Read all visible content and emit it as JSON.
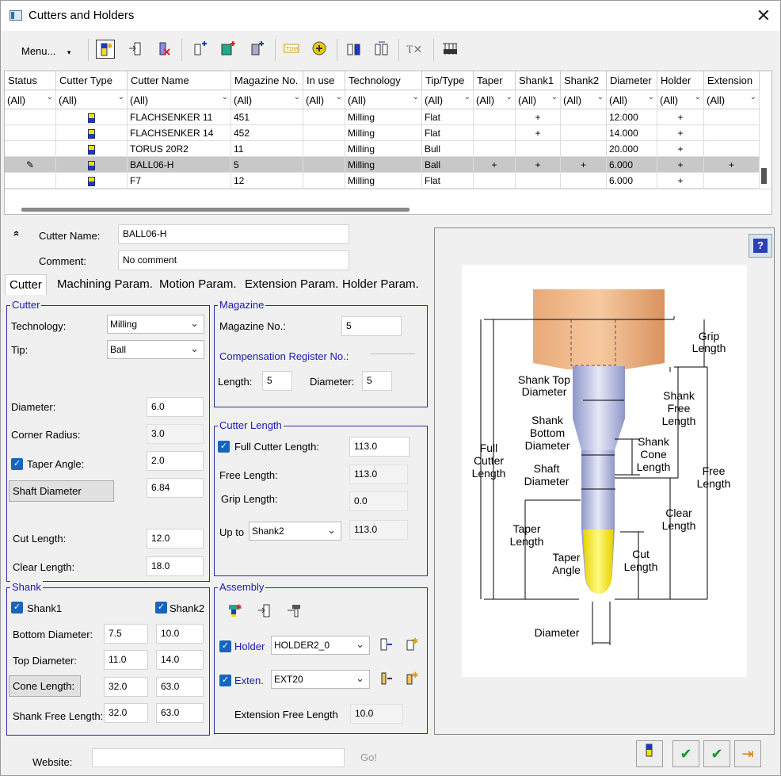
{
  "window": {
    "title": "Cutters and Holders"
  },
  "toolbar": {
    "menu_label": "Menu...",
    "menu_arrow": "▾"
  },
  "grid": {
    "columns": [
      "Status",
      "Cutter Type",
      "Cutter Name",
      "Magazine No.",
      "In use",
      "Technology",
      "Tip/Type",
      "Taper",
      "Shank1",
      "Shank2",
      "Diameter",
      "Holder",
      "Extension"
    ],
    "filter": "(All)",
    "rows": [
      {
        "status": "",
        "name": "FLACHSENKER 11",
        "mag": "451",
        "inuse": "",
        "tech": "Milling",
        "tip": "Flat",
        "taper": "",
        "shank1": "+",
        "shank2": "",
        "diam": "12.000",
        "holder": "+",
        "ext": ""
      },
      {
        "status": "",
        "name": "FLACHSENKER 14",
        "mag": "452",
        "inuse": "",
        "tech": "Milling",
        "tip": "Flat",
        "taper": "",
        "shank1": "+",
        "shank2": "",
        "diam": "14.000",
        "holder": "+",
        "ext": ""
      },
      {
        "status": "",
        "name": "TORUS 20R2",
        "mag": "11",
        "inuse": "",
        "tech": "Milling",
        "tip": "Bull",
        "taper": "",
        "shank1": "",
        "shank2": "",
        "diam": "20.000",
        "holder": "+",
        "ext": ""
      },
      {
        "status": "✎",
        "name": "BALL06-H",
        "mag": "5",
        "inuse": "",
        "tech": "Milling",
        "tip": "Ball",
        "taper": "+",
        "shank1": "+",
        "shank2": "+",
        "diam": "6.000",
        "holder": "+",
        "ext": "+"
      },
      {
        "status": "",
        "name": "F7",
        "mag": "12",
        "inuse": "",
        "tech": "Milling",
        "tip": "Flat",
        "taper": "",
        "shank1": "",
        "shank2": "",
        "diam": "6.000",
        "holder": "+",
        "ext": ""
      }
    ]
  },
  "form": {
    "collapse_icon": "«",
    "cutter_name_label": "Cutter Name:",
    "cutter_name": "BALL06-H",
    "comment_label": "Comment:",
    "comment": "No comment"
  },
  "tabs": [
    "Cutter",
    "Machining Param.",
    "Motion Param.",
    "Extension Param.",
    "Holder Param."
  ],
  "cutter": {
    "title": "Cutter",
    "technology_label": "Technology:",
    "technology": "Milling",
    "tip_label": "Tip:",
    "tip": "Ball",
    "diameter_label": "Diameter:",
    "diameter": "6.0",
    "corner_radius_label": "Corner Radius:",
    "corner_radius": "3.0",
    "taper_angle_label": "Taper Angle:",
    "taper_angle": "2.0",
    "shaft_diameter_label": "Shaft Diameter",
    "shaft_diameter": "6.84",
    "cut_length_label": "Cut Length:",
    "cut_length": "12.0",
    "clear_length_label": "Clear Length:",
    "clear_length": "18.0"
  },
  "magazine": {
    "title": "Magazine",
    "mag_no_label": "Magazine No.:",
    "mag_no": "5",
    "comp_label": "Compensation Register No.:",
    "length_label": "Length:",
    "length": "5",
    "diameter_label": "Diameter:",
    "diameter": "5"
  },
  "cutter_length": {
    "title": "Cutter Length",
    "full_label": "Full Cutter Length:",
    "full": "113.0",
    "free_label": "Free Length:",
    "free": "113.0",
    "grip_label": "Grip Length:",
    "grip": "0.0",
    "upto_label": "Up to",
    "upto": "Shank2",
    "upto_value": "113.0"
  },
  "shank": {
    "title": "Shank",
    "shank1_label": "Shank1",
    "shank2_label": "Shank2",
    "bottom_label": "Bottom Diameter:",
    "bottom1": "7.5",
    "bottom2": "10.0",
    "top_label": "Top Diameter:",
    "top1": "11.0",
    "top2": "14.0",
    "cone_label": "Cone Length:",
    "cone1": "32.0",
    "cone2": "63.0",
    "free_label": "Shank Free Length:",
    "free1": "32.0",
    "free2": "63.0"
  },
  "assembly": {
    "title": "Assembly",
    "holder_label": "Holder",
    "holder": "HOLDER2_0",
    "ext_label": "Exten.",
    "ext": "EXT20",
    "ext_free_label": "Extension Free Length",
    "ext_free": "10.0"
  },
  "diagram": {
    "grip_length": [
      "Grip",
      "Length"
    ],
    "shank_top_diameter": [
      "Shank Top",
      "Diameter"
    ],
    "shank_free_length": [
      "Shank",
      "Free",
      "Length"
    ],
    "shank_bottom_diameter": [
      "Shank",
      "Bottom",
      "Diameter"
    ],
    "shank_cone_length": [
      "Shank",
      "Cone",
      "Length"
    ],
    "full_cutter_length": [
      "Full",
      "Cutter",
      "Length"
    ],
    "free_length": [
      "Free",
      "Length"
    ],
    "shaft_diameter": [
      "Shaft",
      "Diameter"
    ],
    "clear_length": [
      "Clear",
      "Length"
    ],
    "taper_length": [
      "Taper",
      "Length"
    ],
    "taper_angle": [
      "Taper",
      "Angle"
    ],
    "cut_length": [
      "Cut",
      "Length"
    ],
    "diameter": "Diameter"
  },
  "footer": {
    "website_label": "Website:",
    "website": "",
    "go": "Go!"
  },
  "colors": {
    "accent": "#1a1ab0",
    "selected_row": "#c8c8c8",
    "check": "#1565c0"
  }
}
